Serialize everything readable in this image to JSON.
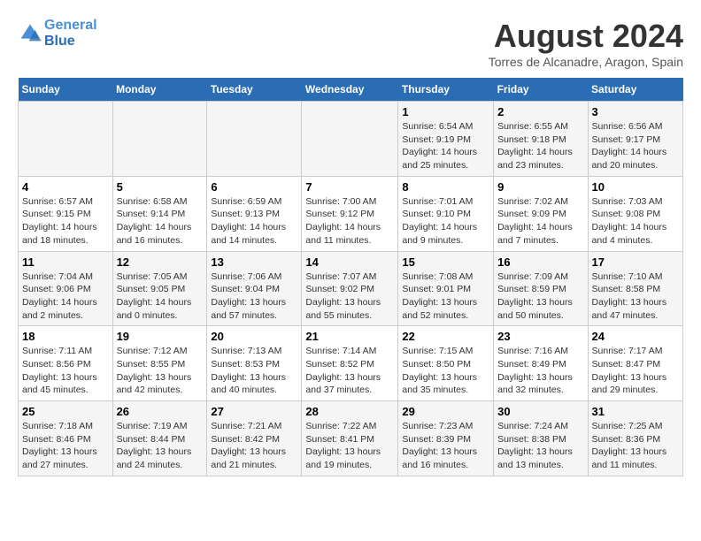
{
  "header": {
    "logo_line1": "General",
    "logo_line2": "Blue",
    "month_year": "August 2024",
    "location": "Torres de Alcanadre, Aragon, Spain"
  },
  "weekdays": [
    "Sunday",
    "Monday",
    "Tuesday",
    "Wednesday",
    "Thursday",
    "Friday",
    "Saturday"
  ],
  "weeks": [
    [
      {
        "day": "",
        "info": ""
      },
      {
        "day": "",
        "info": ""
      },
      {
        "day": "",
        "info": ""
      },
      {
        "day": "",
        "info": ""
      },
      {
        "day": "1",
        "info": "Sunrise: 6:54 AM\nSunset: 9:19 PM\nDaylight: 14 hours\nand 25 minutes."
      },
      {
        "day": "2",
        "info": "Sunrise: 6:55 AM\nSunset: 9:18 PM\nDaylight: 14 hours\nand 23 minutes."
      },
      {
        "day": "3",
        "info": "Sunrise: 6:56 AM\nSunset: 9:17 PM\nDaylight: 14 hours\nand 20 minutes."
      }
    ],
    [
      {
        "day": "4",
        "info": "Sunrise: 6:57 AM\nSunset: 9:15 PM\nDaylight: 14 hours\nand 18 minutes."
      },
      {
        "day": "5",
        "info": "Sunrise: 6:58 AM\nSunset: 9:14 PM\nDaylight: 14 hours\nand 16 minutes."
      },
      {
        "day": "6",
        "info": "Sunrise: 6:59 AM\nSunset: 9:13 PM\nDaylight: 14 hours\nand 14 minutes."
      },
      {
        "day": "7",
        "info": "Sunrise: 7:00 AM\nSunset: 9:12 PM\nDaylight: 14 hours\nand 11 minutes."
      },
      {
        "day": "8",
        "info": "Sunrise: 7:01 AM\nSunset: 9:10 PM\nDaylight: 14 hours\nand 9 minutes."
      },
      {
        "day": "9",
        "info": "Sunrise: 7:02 AM\nSunset: 9:09 PM\nDaylight: 14 hours\nand 7 minutes."
      },
      {
        "day": "10",
        "info": "Sunrise: 7:03 AM\nSunset: 9:08 PM\nDaylight: 14 hours\nand 4 minutes."
      }
    ],
    [
      {
        "day": "11",
        "info": "Sunrise: 7:04 AM\nSunset: 9:06 PM\nDaylight: 14 hours\nand 2 minutes."
      },
      {
        "day": "12",
        "info": "Sunrise: 7:05 AM\nSunset: 9:05 PM\nDaylight: 14 hours\nand 0 minutes."
      },
      {
        "day": "13",
        "info": "Sunrise: 7:06 AM\nSunset: 9:04 PM\nDaylight: 13 hours\nand 57 minutes."
      },
      {
        "day": "14",
        "info": "Sunrise: 7:07 AM\nSunset: 9:02 PM\nDaylight: 13 hours\nand 55 minutes."
      },
      {
        "day": "15",
        "info": "Sunrise: 7:08 AM\nSunset: 9:01 PM\nDaylight: 13 hours\nand 52 minutes."
      },
      {
        "day": "16",
        "info": "Sunrise: 7:09 AM\nSunset: 8:59 PM\nDaylight: 13 hours\nand 50 minutes."
      },
      {
        "day": "17",
        "info": "Sunrise: 7:10 AM\nSunset: 8:58 PM\nDaylight: 13 hours\nand 47 minutes."
      }
    ],
    [
      {
        "day": "18",
        "info": "Sunrise: 7:11 AM\nSunset: 8:56 PM\nDaylight: 13 hours\nand 45 minutes."
      },
      {
        "day": "19",
        "info": "Sunrise: 7:12 AM\nSunset: 8:55 PM\nDaylight: 13 hours\nand 42 minutes."
      },
      {
        "day": "20",
        "info": "Sunrise: 7:13 AM\nSunset: 8:53 PM\nDaylight: 13 hours\nand 40 minutes."
      },
      {
        "day": "21",
        "info": "Sunrise: 7:14 AM\nSunset: 8:52 PM\nDaylight: 13 hours\nand 37 minutes."
      },
      {
        "day": "22",
        "info": "Sunrise: 7:15 AM\nSunset: 8:50 PM\nDaylight: 13 hours\nand 35 minutes."
      },
      {
        "day": "23",
        "info": "Sunrise: 7:16 AM\nSunset: 8:49 PM\nDaylight: 13 hours\nand 32 minutes."
      },
      {
        "day": "24",
        "info": "Sunrise: 7:17 AM\nSunset: 8:47 PM\nDaylight: 13 hours\nand 29 minutes."
      }
    ],
    [
      {
        "day": "25",
        "info": "Sunrise: 7:18 AM\nSunset: 8:46 PM\nDaylight: 13 hours\nand 27 minutes."
      },
      {
        "day": "26",
        "info": "Sunrise: 7:19 AM\nSunset: 8:44 PM\nDaylight: 13 hours\nand 24 minutes."
      },
      {
        "day": "27",
        "info": "Sunrise: 7:21 AM\nSunset: 8:42 PM\nDaylight: 13 hours\nand 21 minutes."
      },
      {
        "day": "28",
        "info": "Sunrise: 7:22 AM\nSunset: 8:41 PM\nDaylight: 13 hours\nand 19 minutes."
      },
      {
        "day": "29",
        "info": "Sunrise: 7:23 AM\nSunset: 8:39 PM\nDaylight: 13 hours\nand 16 minutes."
      },
      {
        "day": "30",
        "info": "Sunrise: 7:24 AM\nSunset: 8:38 PM\nDaylight: 13 hours\nand 13 minutes."
      },
      {
        "day": "31",
        "info": "Sunrise: 7:25 AM\nSunset: 8:36 PM\nDaylight: 13 hours\nand 11 minutes."
      }
    ]
  ]
}
